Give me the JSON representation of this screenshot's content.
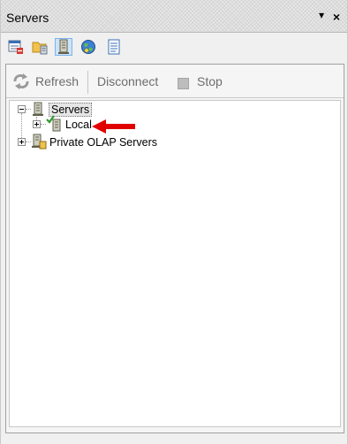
{
  "window": {
    "title": "Servers",
    "pin_glyph": "▾",
    "close_glyph": "×"
  },
  "toolbar": {
    "icons": [
      "server-list-icon",
      "folder-icon",
      "server-icon",
      "globe-icon",
      "document-icon"
    ]
  },
  "commands": {
    "refresh": "Refresh",
    "disconnect": "Disconnect",
    "stop": "Stop"
  },
  "tree": {
    "root": "Servers",
    "children": [
      {
        "label": "Local",
        "icon": "server-connected-icon"
      },
      {
        "label": "Private OLAP Servers",
        "icon": "olap-server-icon"
      }
    ]
  },
  "annotation": {
    "arrow_color": "#e00000"
  }
}
